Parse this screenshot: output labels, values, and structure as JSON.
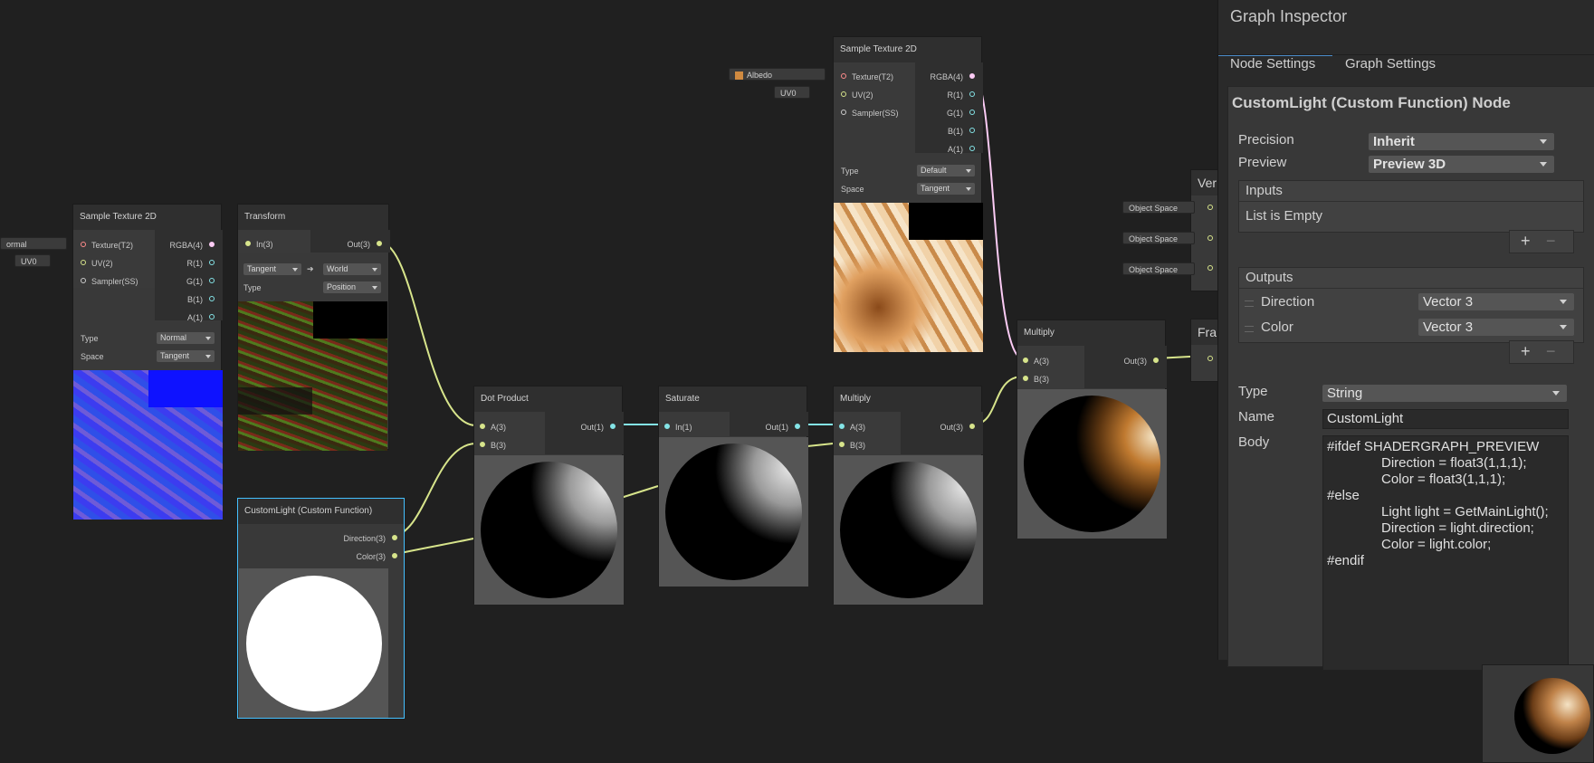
{
  "inspector": {
    "title": "Graph Inspector",
    "tabs": [
      "Node Settings",
      "Graph Settings"
    ],
    "node_title": "CustomLight (Custom Function) Node",
    "precision_label": "Precision",
    "precision_value": "Inherit",
    "preview_label": "Preview",
    "preview_value": "Preview 3D",
    "inputs_header": "Inputs",
    "inputs_empty": "List is Empty",
    "outputs_header": "Outputs",
    "outputs": [
      {
        "name": "Direction",
        "type": "Vector 3"
      },
      {
        "name": "Color",
        "type": "Vector 3"
      }
    ],
    "type_label": "Type",
    "type_value": "String",
    "name_label": "Name",
    "name_value": "CustomLight",
    "body_label": "Body",
    "body_lines": [
      "#ifdef SHADERGRAPH_PREVIEW",
      "Direction = float3(1,1,1);",
      "Color = float3(1,1,1);",
      "#else",
      "Light light = GetMainLight();",
      "Direction = light.direction;",
      "Color = light.color;",
      "#endif"
    ],
    "plus": "+",
    "minus": "−"
  },
  "nodes": {
    "sample_normal": {
      "title": "Sample Texture 2D",
      "inputs": [
        "Texture(T2)",
        "UV(2)",
        "Sampler(SS)"
      ],
      "outputs": [
        "RGBA(4)",
        "R(1)",
        "G(1)",
        "B(1)",
        "A(1)"
      ],
      "type_label": "Type",
      "type_value": "Normal",
      "space_label": "Space",
      "space_value": "Tangent",
      "tex_chip": "ormal",
      "uv_chip": "UV0"
    },
    "transform": {
      "title": "Transform",
      "input": "In(3)",
      "output": "Out(3)",
      "from_space": "Tangent",
      "arrow": "➔",
      "to_space": "World",
      "type_label": "Type",
      "type_value": "Position"
    },
    "custom_light": {
      "title": "CustomLight (Custom Function)",
      "outputs": [
        "Direction(3)",
        "Color(3)"
      ]
    },
    "dot_product": {
      "title": "Dot Product",
      "inputs": [
        "A(3)",
        "B(3)"
      ],
      "output": "Out(1)"
    },
    "saturate": {
      "title": "Saturate",
      "input": "In(1)",
      "output": "Out(1)"
    },
    "multiply1": {
      "title": "Multiply",
      "inputs": [
        "A(3)",
        "B(3)"
      ],
      "output": "Out(3)"
    },
    "sample_albedo": {
      "title": "Sample Texture 2D",
      "inputs": [
        "Texture(T2)",
        "UV(2)",
        "Sampler(SS)"
      ],
      "outputs": [
        "RGBA(4)",
        "R(1)",
        "G(1)",
        "B(1)",
        "A(1)"
      ],
      "type_label": "Type",
      "type_value": "Default",
      "space_label": "Space",
      "space_value": "Tangent",
      "tex_chip": "Albedo",
      "uv_chip": "UV0"
    },
    "multiply2": {
      "title": "Multiply",
      "inputs": [
        "A(3)",
        "B(3)"
      ],
      "output": "Out(3)"
    },
    "vertex": {
      "title": "Ver"
    },
    "fragment": {
      "title": "Fra"
    },
    "object_space_chips": [
      "Object Space",
      "Object Space",
      "Object Space"
    ]
  },
  "colors": {
    "canvas": "#202020",
    "node_body": "#393939",
    "wire_vector3": "#d7e48b",
    "wire_float": "#84e4e7",
    "wire_vector4": "#fbcbf4",
    "texture_port": "#ff8b8b",
    "selection": "#44c0ff"
  }
}
